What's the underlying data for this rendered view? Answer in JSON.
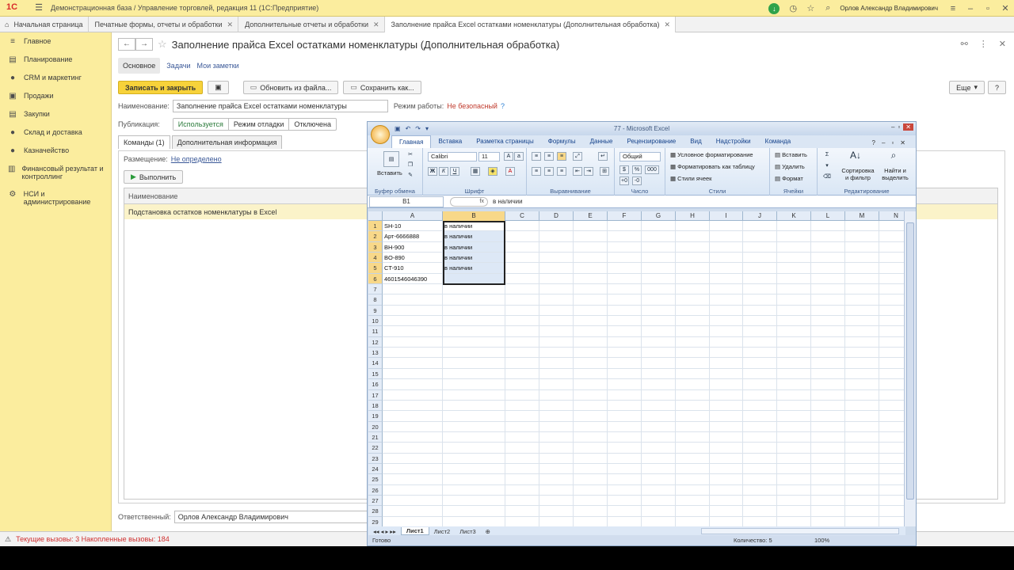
{
  "titlebar": {
    "logo": "1С",
    "title": "Демонстрационная база / Управление торговлей, редакция 11  (1С:Предприятие)",
    "user": "Орлов Александр Владимирович"
  },
  "tabs": [
    {
      "label": "Начальная страница"
    },
    {
      "label": "Печатные формы, отчеты и обработки"
    },
    {
      "label": "Дополнительные отчеты и обработки"
    },
    {
      "label": "Заполнение прайса Excel остатками номенклатуры (Дополнительная обработка)"
    }
  ],
  "sidebar": {
    "items": [
      {
        "label": "Главное",
        "icon": "≡"
      },
      {
        "label": "Планирование",
        "icon": "▤"
      },
      {
        "label": "CRM и маркетинг",
        "icon": "●"
      },
      {
        "label": "Продажи",
        "icon": "▣"
      },
      {
        "label": "Закупки",
        "icon": "▤"
      },
      {
        "label": "Склад и доставка",
        "icon": "●"
      },
      {
        "label": "Казначейство",
        "icon": "●"
      },
      {
        "label": "Финансовый результат и контроллинг",
        "icon": "▥"
      },
      {
        "label": "НСИ и администрирование",
        "icon": "⚙"
      }
    ]
  },
  "form": {
    "title": "Заполнение прайса Excel остатками номенклатуры (Дополнительная обработка)",
    "subtabs": {
      "main": "Основное",
      "tasks": "Задачи",
      "notes": "Мои заметки"
    },
    "toolbar": {
      "save_close": "Записать и закрыть",
      "update_from_file": "Обновить из файла...",
      "save_as": "Сохранить как...",
      "more": "Еще"
    },
    "name_label": "Наименование:",
    "name_value": "Заполнение прайса Excel остатками номенклатуры",
    "mode_label": "Режим работы:",
    "mode_value": "Не безопасный",
    "mode_help": "?",
    "pub_label": "Публикация:",
    "pub_options": [
      "Используется",
      "Режим отладки",
      "Отключена"
    ],
    "page_tabs": [
      "Команды (1)",
      "Дополнительная информация"
    ],
    "placement_label": "Размещение:",
    "placement_value": "Не определено",
    "run_label": "Выполнить",
    "grid_header": "Наименование",
    "grid_row": "Подстановка остатков номенклатуры в Excel",
    "resp_label": "Ответственный:",
    "resp_value": "Орлов Александр Владимирович"
  },
  "statusbar": {
    "text": "Текущие вызовы: 3   Накопленные вызовы: 184"
  },
  "excel": {
    "title": "77 - Microsoft Excel",
    "menu": [
      "Главная",
      "Вставка",
      "Разметка страницы",
      "Формулы",
      "Данные",
      "Рецензирование",
      "Вид",
      "Надстройки",
      "Команда"
    ],
    "ribbon": {
      "paste": "Вставить",
      "clipboard": "Буфер обмена",
      "font_name": "Calibri",
      "font_size": "11",
      "font_group": "Шрифт",
      "align_group": "Выравнивание",
      "number_format": "Общий",
      "number_group": "Число",
      "cond_format": "Условное форматирование",
      "format_table": "Форматировать как таблицу",
      "cell_styles": "Стили ячеек",
      "styles_group": "Стили",
      "insert": "Вставить",
      "delete": "Удалить",
      "format": "Формат",
      "cells_group": "Ячейки",
      "sort_filter": "Сортировка и фильтр",
      "find_select": "Найти и выделить",
      "edit_group": "Редактирование"
    },
    "namebox": "B1",
    "formula": "в наличии",
    "columns": [
      "A",
      "B",
      "C",
      "D",
      "E",
      "F",
      "G",
      "H",
      "I",
      "J",
      "K",
      "L",
      "M",
      "N"
    ],
    "data": [
      [
        "SH-10",
        "в наличии"
      ],
      [
        "Арт-6666888",
        "в наличии"
      ],
      [
        "BH-900",
        "в наличии"
      ],
      [
        "BO-890",
        "в наличии"
      ],
      [
        "CT-910",
        "в наличии"
      ],
      [
        "4601546046390",
        ""
      ]
    ],
    "total_rows": 29,
    "sheet_tabs": [
      "Лист1",
      "Лист2",
      "Лист3"
    ],
    "status_ready": "Готово",
    "status_count": "Количество: 5",
    "zoom": "100%"
  }
}
